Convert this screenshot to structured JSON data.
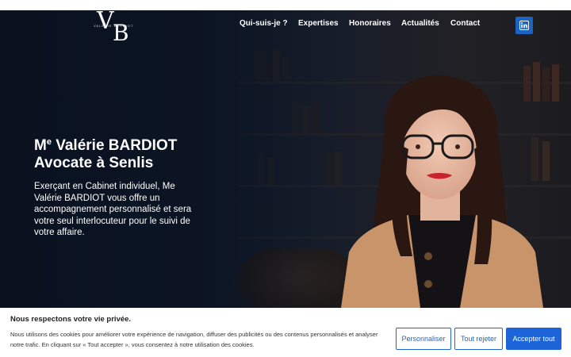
{
  "logo": {
    "letter_v": "V",
    "letter_b": "B",
    "tagline": "VALÉRIE BARDIOT"
  },
  "nav": {
    "items": [
      {
        "label": "Qui-suis-je ?"
      },
      {
        "label": "Expertises"
      },
      {
        "label": "Honoraires"
      },
      {
        "label": "Actualités"
      },
      {
        "label": "Contact"
      }
    ]
  },
  "social": {
    "linkedin_icon": "linkedin-icon",
    "linkedin_color": "#1d64c0"
  },
  "hero": {
    "title_prefix": "M",
    "title_sup": "e",
    "title_name": " Valérie BARDIOT",
    "title_line2": "Avocate à Senlis",
    "intro": "Exerçant en Cabinet individuel, Me Valérie BARDIOT vous offre un accompagnement personnalisé et sera votre seul interlocuteur pour le suivi de votre affaire."
  },
  "cookie_banner": {
    "title": "Nous respectons votre vie privée.",
    "text": "Nous utilisons des cookies pour améliorer votre expérience de navigation, diffuser des publicités ou des contenus personnalisés et analyser notre trafic. En cliquant sur « Tout accepter », vous consentez à notre utilisation des cookies.",
    "customize_label": "Personnaliser",
    "reject_label": "Tout rejeter",
    "accept_label": "Accepter tout",
    "accent_color": "#1d64d8"
  }
}
